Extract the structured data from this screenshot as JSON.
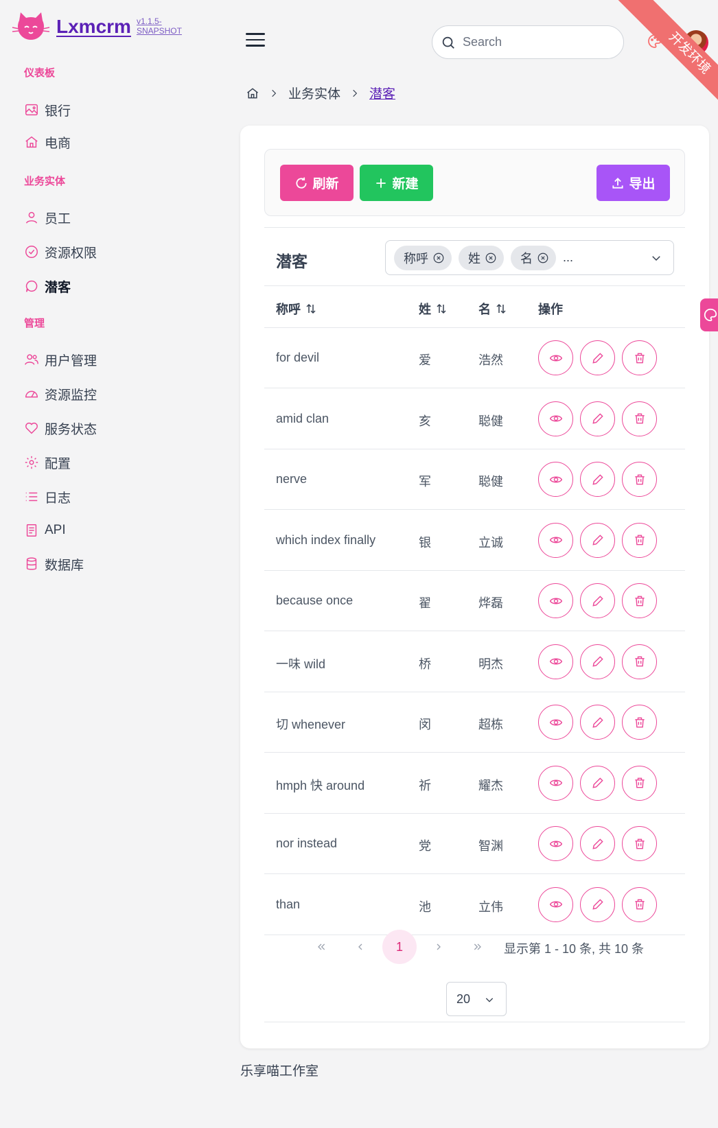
{
  "brand": {
    "name": "Lxmcrm",
    "version": "v1.1.5-SNAPSHOT"
  },
  "sidebar": {
    "sections": [
      {
        "title": "仪表板",
        "items": [
          {
            "label": "银行",
            "icon": "image-icon"
          },
          {
            "label": "电商",
            "icon": "home-icon"
          }
        ]
      },
      {
        "title": "业务实体",
        "items": [
          {
            "label": "员工",
            "icon": "user-icon"
          },
          {
            "label": "资源权限",
            "icon": "check-circle-icon"
          },
          {
            "label": "潜客",
            "icon": "chat-bubble-icon",
            "active": true
          }
        ]
      },
      {
        "title": "管理",
        "items": [
          {
            "label": "用户管理",
            "icon": "users-icon"
          },
          {
            "label": "资源监控",
            "icon": "gauge-icon"
          },
          {
            "label": "服务状态",
            "icon": "heart-icon"
          },
          {
            "label": "配置",
            "icon": "gear-icon"
          },
          {
            "label": "日志",
            "icon": "list-icon"
          },
          {
            "label": "API",
            "icon": "document-icon"
          },
          {
            "label": "数据库",
            "icon": "database-icon"
          }
        ]
      }
    ]
  },
  "topbar": {
    "search_placeholder": "Search",
    "ribbon": "开发环境"
  },
  "breadcrumb": {
    "items": [
      "业务实体",
      "潜客"
    ]
  },
  "toolbar": {
    "refresh": "刷新",
    "new": "新建",
    "export": "导出"
  },
  "table": {
    "title": "潜客",
    "column_chips": [
      "称呼",
      "姓",
      "名"
    ],
    "more": "...",
    "headers": {
      "salutation": "称呼",
      "last": "姓",
      "first": "名",
      "actions": "操作"
    },
    "rows": [
      {
        "salutation": "for devil",
        "last": "爱",
        "first": "浩然"
      },
      {
        "salutation": "amid clan",
        "last": "亥",
        "first": "聪健"
      },
      {
        "salutation": "nerve",
        "last": "军",
        "first": "聪健"
      },
      {
        "salutation": "which index finally",
        "last": "银",
        "first": "立诚"
      },
      {
        "salutation": "because once",
        "last": "翟",
        "first": "烨磊"
      },
      {
        "salutation": "一味 wild",
        "last": "桥",
        "first": "明杰"
      },
      {
        "salutation": "切 whenever",
        "last": "闵",
        "first": "超栋"
      },
      {
        "salutation": "hmph 快 around",
        "last": "祈",
        "first": "耀杰"
      },
      {
        "salutation": "nor instead",
        "last": "党",
        "first": "智渊"
      },
      {
        "salutation": "than",
        "last": "池",
        "first": "立伟"
      }
    ]
  },
  "pagination": {
    "current_page": "1",
    "info": "显示第 1 - 10 条, 共 10 条",
    "page_size": "20"
  },
  "footer": {
    "text": "乐享喵工作室"
  },
  "colors": {
    "primary": "#ec4899",
    "success": "#22c55e",
    "secondary": "#a855f7",
    "ribbon": "#f07070"
  }
}
